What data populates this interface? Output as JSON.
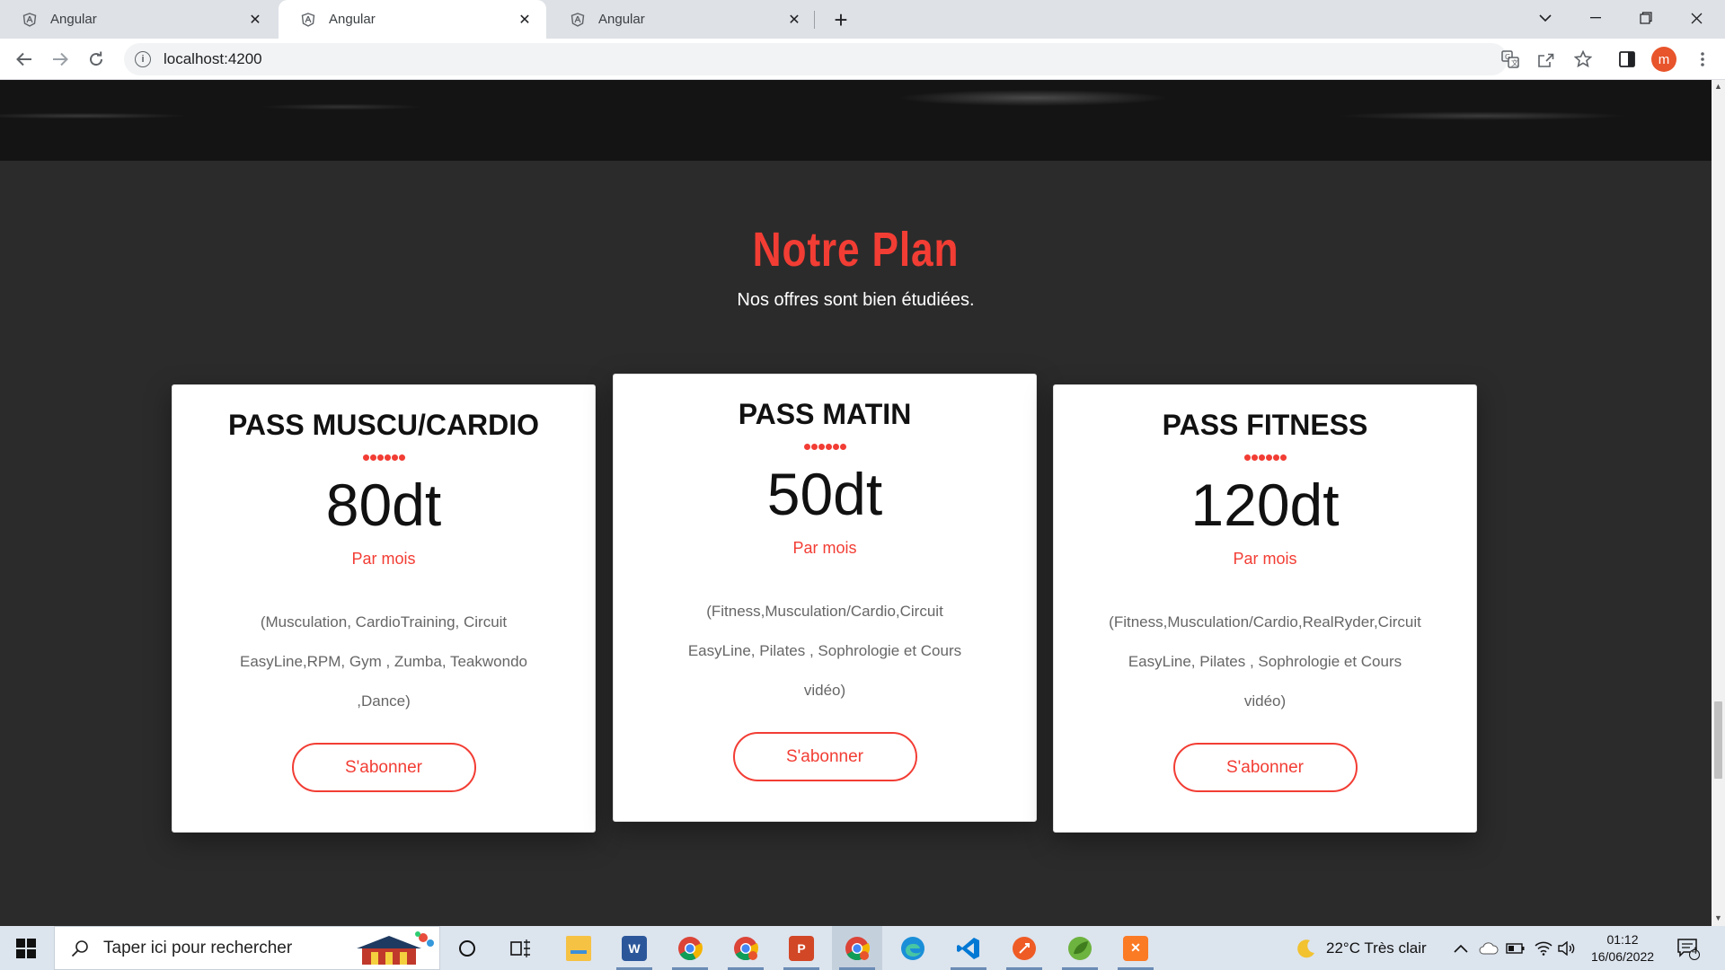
{
  "browser": {
    "tabs": [
      {
        "title": "Angular"
      },
      {
        "title": "Angular"
      },
      {
        "title": "Angular"
      }
    ],
    "url": "localhost:4200",
    "profile_initial": "m"
  },
  "section": {
    "title": "Notre Plan",
    "subtitle": "Nos offres sont bien étudiées."
  },
  "plans": [
    {
      "name": "PASS MUSCU/CARDIO",
      "price": "80dt",
      "period": "Par mois",
      "lines": [
        "(Musculation, CardioTraining, Circuit",
        "EasyLine,RPM, Gym , Zumba, Teakwondo",
        ",Dance)"
      ],
      "button": "S'abonner"
    },
    {
      "name": "PASS MATIN",
      "price": "50dt",
      "period": "Par mois",
      "lines": [
        "(Fitness,Musculation/Cardio,Circuit",
        "EasyLine, Pilates , Sophrologie et Cours",
        "vidéo)"
      ],
      "button": "S'abonner"
    },
    {
      "name": "PASS FITNESS",
      "price": "120dt",
      "period": "Par mois",
      "lines": [
        "(Fitness,Musculation/Cardio,RealRyder,Circuit",
        "EasyLine, Pilates , Sophrologie et Cours",
        "vidéo)"
      ],
      "button": "S'abonner"
    }
  ],
  "colors": {
    "accent": "#f23d34",
    "page_bg": "#2b2b2b",
    "card_bg": "#ffffff"
  },
  "taskbar": {
    "search_placeholder": "Taper ici pour rechercher",
    "weather": "22°C  Très clair",
    "time": "01:12",
    "date": "16/06/2022",
    "notifications": "4",
    "apps": [
      "task-view",
      "file-explorer",
      "word",
      "chrome",
      "chrome-profile",
      "powerpoint",
      "chrome-active",
      "edge",
      "vscode",
      "postman",
      "spring-tool-suite",
      "xampp"
    ]
  }
}
